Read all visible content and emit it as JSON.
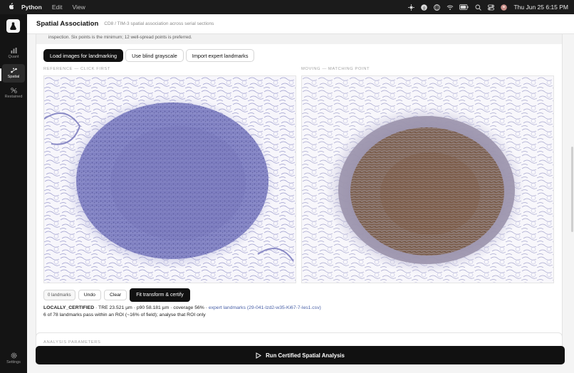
{
  "menubar": {
    "app_name": "Python",
    "menus": [
      "Edit",
      "View"
    ],
    "clock": "Thu Jun 25  6:15 PM",
    "icons": [
      "apple-icon",
      "sparkle-icon",
      "vpn-icon",
      "globe-icon",
      "wifi-icon",
      "battery-icon",
      "search-icon",
      "control-center-icon",
      "user-icon"
    ]
  },
  "rail": {
    "items": [
      {
        "label": "Quant",
        "icon": "bar-chart-icon"
      },
      {
        "label": "Spatial",
        "icon": "spatial-icon"
      },
      {
        "label": "Restained",
        "icon": "restained-icon"
      }
    ],
    "settings_label": "Settings"
  },
  "header": {
    "title": "Spatial Association",
    "subtitle": "CD8 / TIM-3 spatial association across serial sections"
  },
  "card": {
    "note": "inspection. Six points is the minimum; 12 well-spread points is preferred.",
    "buttons": {
      "load": "Load images for landmarking",
      "blind": "Use blind grayscale",
      "import": "Import expert landmarks"
    },
    "reference_caption": "REFERENCE — CLICK FIRST",
    "moving_caption": "MOVING — MATCHING POINT",
    "tools": {
      "count": "0 landmarks",
      "undo": "Undo",
      "clear": "Clear",
      "fit": "Fit transform & certify"
    },
    "status": {
      "state": "LOCALLY_CERTIFIED",
      "metrics": " · TRE 23.521 µm · p90 58.181 µm · coverage 56% · ",
      "link": "expert landmarks (29-041-lzd2-w35-Ki67-7-les1.csv)",
      "line2": "6 of 78 landmarks pass within an ROI (~16% of field); analyse that ROI only"
    }
  },
  "params": {
    "label": "ANALYSIS PARAMETERS"
  },
  "run_button": "Run Certified Spatial Analysis",
  "colors": {
    "accent": "#111111",
    "link": "#4b62a8",
    "he_tissue": "#7b7cc0",
    "dab_tissue": "#8a6a52"
  }
}
